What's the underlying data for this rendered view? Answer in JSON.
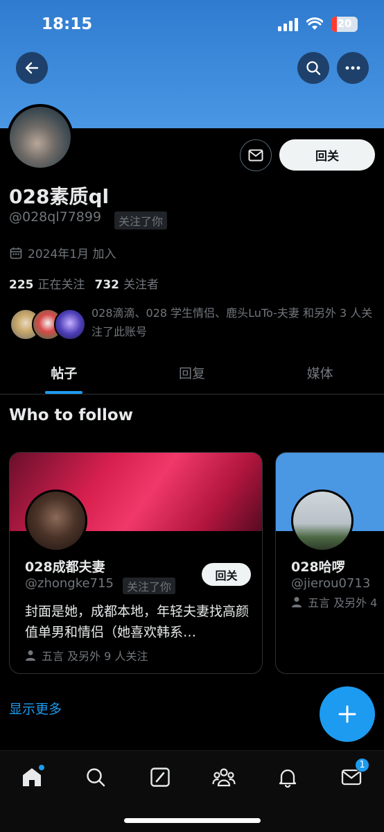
{
  "status_bar": {
    "time": "18:15",
    "battery": "20"
  },
  "profile": {
    "name": "028素质ql",
    "handle": "@028ql77899",
    "follows_you_badge": "关注了你",
    "joined": "2024年1月 加入",
    "following_count": "225",
    "following_label": "正在关注",
    "followers_count": "732",
    "followers_label": "关注者",
    "follow_back_label": "回关",
    "mutuals_text": "028滴滴、028 学生情侣、鹿头LuTo-夫妻 和另外 3 人关注了此账号"
  },
  "tabs": [
    {
      "label": "帖子",
      "active": true
    },
    {
      "label": "回复",
      "active": false
    },
    {
      "label": "媒体",
      "active": false
    }
  ],
  "who_to_follow": {
    "title": "Who to follow",
    "cards": [
      {
        "name": "028成都夫妻",
        "handle": "@zhongke715",
        "badge": "关注了你",
        "button": "回关",
        "bio": "封面是她，成都本地，年轻夫妻找高颜值单男和情侣（她喜欢韩系…",
        "social": "五言 及另外 9 人关注"
      },
      {
        "name": "028哈啰",
        "handle": "@jierou0713",
        "social": "五言 及另外 4"
      }
    ],
    "show_more": "显示更多"
  },
  "bottom_nav": {
    "items": [
      "home-icon",
      "search-icon",
      "grok-icon",
      "communities-icon",
      "notifications-icon",
      "messages-icon"
    ],
    "messages_badge": "1"
  },
  "colors": {
    "accent": "#1d9bf0",
    "banner": "#4a97e4",
    "background": "#000000"
  }
}
